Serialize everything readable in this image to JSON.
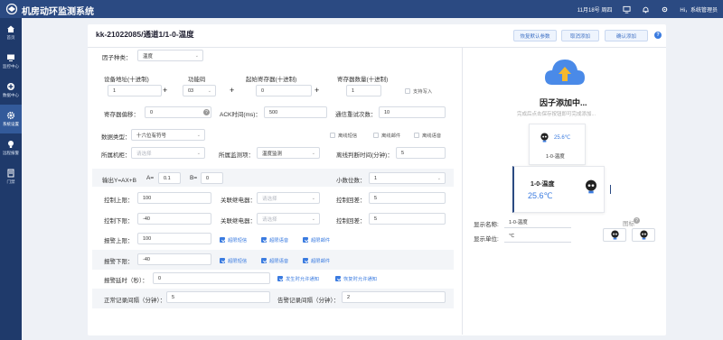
{
  "app": {
    "title": "机房动环监测系统"
  },
  "topbar": {
    "date": "11月18号 周四",
    "user": "Hi，系统管理员"
  },
  "sidebar": {
    "items": [
      {
        "label": "首页",
        "icon": "home-icon"
      },
      {
        "label": "监控中心",
        "icon": "monitor-icon"
      },
      {
        "label": "数据中心",
        "icon": "data-center-icon"
      },
      {
        "label": "系统设置",
        "icon": "gear-icon",
        "active": true
      },
      {
        "label": "远程报警",
        "icon": "bulb-icon"
      },
      {
        "label": "门禁",
        "icon": "door-icon"
      }
    ]
  },
  "header": {
    "title": "kk-21022085/通道1/1-0-温度",
    "restore_btn": "恢复默认参数",
    "cancel_btn": "取消添加",
    "confirm_btn": "确认添加",
    "help": "?"
  },
  "form": {
    "factor_type": {
      "label": "因子种类：",
      "value": "温度"
    },
    "device_addr": {
      "label": "设备地址(十进制)",
      "value": "1"
    },
    "func_code": {
      "label": "功能码",
      "value": "03"
    },
    "start_reg": {
      "label": "起始寄存器(十进制)",
      "value": "0"
    },
    "reg_count": {
      "label": "寄存器数量(十进制)",
      "value": "1"
    },
    "support_write": "支持写入",
    "reg_offset": {
      "label": "寄存器偏移：",
      "value": "0"
    },
    "ack_time": {
      "label": "ACK时间(ms)：",
      "value": "500"
    },
    "retry": {
      "label": "通信重试次数：",
      "value": "10"
    },
    "data_type": {
      "label": "数据类型：",
      "value": "十六位有符号"
    },
    "offline_sms": "离线短信",
    "offline_mail": "离线邮件",
    "offline_voice": "离线语音",
    "cabinet": {
      "label": "所属机柜：",
      "placeholder": "请选择"
    },
    "monitor_item": {
      "label": "所属监测项：",
      "value": "温度监测"
    },
    "offline_judge": {
      "label": "离线判断时间(分钟)：",
      "value": "5"
    },
    "formula": {
      "label": "输出Y=AX+B",
      "a_label": "A=",
      "a_value": "0.1",
      "b_label": "B=",
      "b_value": "0"
    },
    "decimals": {
      "label": "小数位数：",
      "value": "1"
    },
    "ctrl_upper": {
      "label": "控制上限：",
      "value": "100"
    },
    "relay1": {
      "label": "关联继电器：",
      "placeholder": "请选择"
    },
    "ctrl_diff1": {
      "label": "控制回差：",
      "value": "5"
    },
    "ctrl_lower": {
      "label": "控制下限：",
      "value": "-40"
    },
    "relay2": {
      "label": "关联继电器：",
      "placeholder": "请选择"
    },
    "ctrl_diff2": {
      "label": "控制回差：",
      "value": "5"
    },
    "alarm_upper": {
      "label": "报警上限：",
      "value": "100"
    },
    "alarm_lower": {
      "label": "报警下限：",
      "value": "-40"
    },
    "over_sms": "超限短信",
    "over_voice": "超限语音",
    "over_mail": "超限邮件",
    "alarm_delay": {
      "label": "报警延时（秒）：",
      "value": "0"
    },
    "notify_on": "发生时允许通知",
    "notify_recover": "恢复时允许通知",
    "normal_interval": {
      "label": "正常记录间隔（分钟）：",
      "value": "5"
    },
    "alarm_interval": {
      "label": "告警记录间隔（分钟）：",
      "value": "2"
    }
  },
  "preview": {
    "cloud_title": "因子添加中...",
    "cloud_sub": "完成后点击保存按钮即可完成添加...",
    "small_value": "25.6℃",
    "small_name": "1-0-温度",
    "big_name": "1-0-温度",
    "big_value": "25.6℃",
    "display_name_label": "显示名称:",
    "display_name_value": "1-0-温度",
    "display_unit_label": "显示单位:",
    "display_unit_value": "℃",
    "icon_label": "图标",
    "colors": {
      "accent": "#3a7be0",
      "header": "#2b4a82",
      "sidebar": "#1f3a6b",
      "cloud": "#4a8ae8",
      "arrow": "#f5b82e"
    }
  }
}
